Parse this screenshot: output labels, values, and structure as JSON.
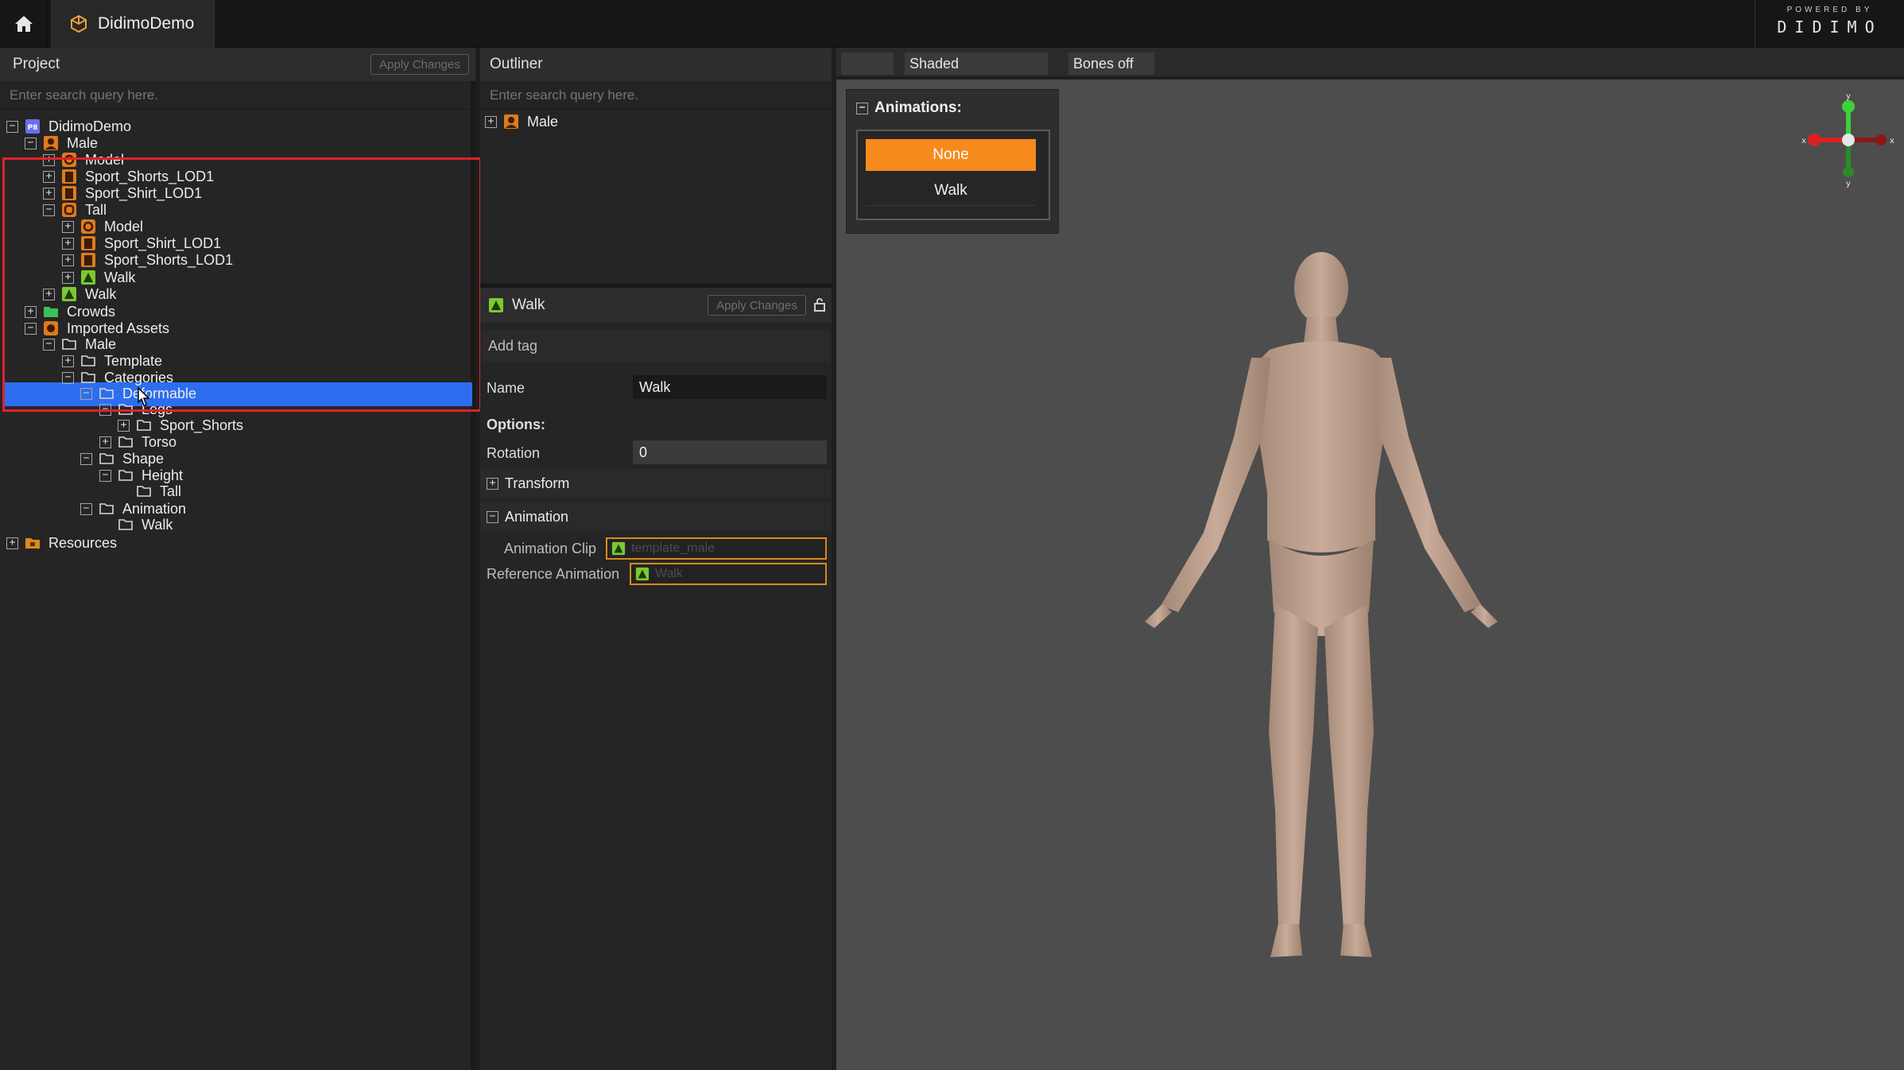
{
  "topbar": {
    "app_tab": "DidimoDemo",
    "powered_by": "POWERED BY",
    "brand": "DIDIMO"
  },
  "project": {
    "title": "Project",
    "apply_changes": "Apply Changes",
    "search_placeholder": "Enter search query here.",
    "tree": [
      {
        "label": "DidimoDemo",
        "toggle": "−",
        "icon": "project-icon",
        "icon_text": "P8"
      },
      {
        "label": "Male",
        "toggle": "−",
        "icon": "character-icon"
      },
      {
        "label": "Model",
        "toggle": "+",
        "icon": "model-icon"
      },
      {
        "label": "Sport_Shorts_LOD1",
        "toggle": "+",
        "icon": "garment-icon"
      },
      {
        "label": "Sport_Shirt_LOD1",
        "toggle": "+",
        "icon": "garment-icon"
      },
      {
        "label": "Tall",
        "toggle": "−",
        "icon": "shape-icon"
      },
      {
        "label": "Model",
        "toggle": "+",
        "icon": "model-icon"
      },
      {
        "label": "Sport_Shirt_LOD1",
        "toggle": "+",
        "icon": "garment-icon"
      },
      {
        "label": "Sport_Shorts_LOD1",
        "toggle": "+",
        "icon": "garment-icon"
      },
      {
        "label": "Walk",
        "toggle": "+",
        "icon": "animation-icon"
      },
      {
        "label": "Walk",
        "toggle": "+",
        "icon": "animation-icon"
      },
      {
        "label": "Crowds",
        "toggle": "+",
        "icon": "crowds-folder-icon"
      },
      {
        "label": "Imported Assets",
        "toggle": "−",
        "icon": "imported-assets-icon"
      },
      {
        "label": "Male",
        "toggle": "−",
        "icon": "folder-icon"
      },
      {
        "label": "Template",
        "toggle": "+",
        "icon": "folder-icon"
      },
      {
        "label": "Categories",
        "toggle": "−",
        "icon": "folder-icon"
      },
      {
        "label": "Deformable",
        "toggle": "−",
        "icon": "folder-icon"
      },
      {
        "label": "Legs",
        "toggle": "−",
        "icon": "folder-icon"
      },
      {
        "label": "Sport_Shorts",
        "toggle": "+",
        "icon": "folder-icon"
      },
      {
        "label": "Torso",
        "toggle": "+",
        "icon": "folder-icon"
      },
      {
        "label": "Shape",
        "toggle": "−",
        "icon": "folder-icon"
      },
      {
        "label": "Height",
        "toggle": "−",
        "icon": "folder-icon"
      },
      {
        "label": "Tall",
        "toggle": "",
        "icon": "folder-icon"
      },
      {
        "label": "Animation",
        "toggle": "−",
        "icon": "folder-icon"
      },
      {
        "label": "Walk",
        "toggle": "",
        "icon": "folder-icon"
      },
      {
        "label": "Resources",
        "toggle": "+",
        "icon": "resources-folder-icon"
      }
    ]
  },
  "outliner": {
    "title": "Outliner",
    "search_placeholder": "Enter search query here.",
    "items": [
      {
        "label": "Male",
        "toggle": "+"
      }
    ]
  },
  "inspector": {
    "title": "Walk",
    "apply_changes": "Apply Changes",
    "add_tag": "Add tag",
    "name_label": "Name",
    "name_value": "Walk",
    "options_label": "Options:",
    "rotation_label": "Rotation",
    "rotation_value": "0",
    "transform_label": "Transform",
    "animation_label": "Animation",
    "animation_clip_label": "Animation Clip",
    "animation_clip_value": "template_male",
    "reference_animation_label": "Reference Animation",
    "reference_animation_value": "Walk"
  },
  "viewport": {
    "mode_button": "Shaded",
    "bones_button": "Bones off",
    "animations_title": "Animations:",
    "animations": [
      "None",
      "Walk"
    ],
    "selected_animation": "None",
    "gizmo": {
      "x": "x",
      "y": "y"
    }
  },
  "colors": {
    "selection": "#2d6ef0",
    "highlight_box": "#e0222a",
    "accent_orange": "#f78a1c",
    "animation_green": "#7cc832"
  }
}
